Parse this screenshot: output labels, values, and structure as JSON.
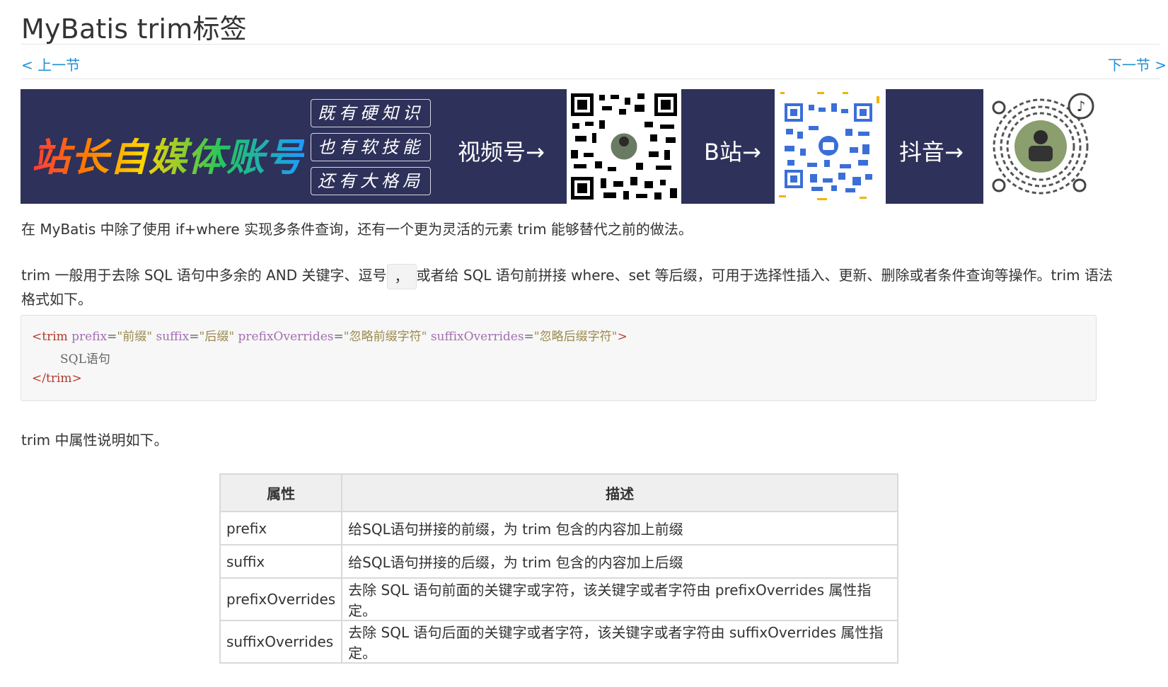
{
  "page": {
    "title": "MyBatis trim标签",
    "nav": {
      "prev": "< 上一节",
      "next": "下一节 >"
    }
  },
  "banner": {
    "brand": "站长自媒体账号",
    "slogans": [
      "既有硬知识",
      "也有软技能",
      "还有大格局"
    ],
    "labels": {
      "video": "视频号→",
      "bilibili": "B站→",
      "douyin": "抖音→"
    }
  },
  "content": {
    "intro": "在 MyBatis 中除了使用 if+where 实现多条件查询，还有一个更为灵活的元素 trim 能够替代之前的做法。",
    "p2_before": "trim 一般用于去除 SQL 语句中多余的 AND 关键字、逗号",
    "p2_code": "，",
    "p2_after": "或者给 SQL 语句前拼接 where、set 等后缀，可用于选择性插入、更新、删除或者条件查询等操作。trim 语法",
    "p2_line2": "格式如下。",
    "code": {
      "open_tag": "trim",
      "attr1_name": "prefix",
      "attr1_value": "\"前缀\"",
      "attr2_name": "suffix",
      "attr2_value": "\"后缀\"",
      "attr3_name": "prefixOverrides",
      "attr3_value": "\"忽略前缀字符\"",
      "attr4_name": "suffixOverrides",
      "attr4_value": "\"忽略后缀字符\"",
      "body": "SQL语句",
      "close_tag": "trim"
    },
    "p3": "trim 中属性说明如下。"
  },
  "table": {
    "headers": [
      "属性",
      "描述"
    ],
    "rows": [
      [
        "prefix",
        "给SQL语句拼接的前缀，为 trim 包含的内容加上前缀"
      ],
      [
        "suffix",
        "给SQL语句拼接的后缀，为 trim 包含的内容加上后缀"
      ],
      [
        "prefixOverrides",
        "去除 SQL 语句前面的关键字或字符，该关键字或者字符由 prefixOverrides 属性指定。"
      ],
      [
        "suffixOverrides",
        "去除 SQL 语句后面的关键字或者字符，该关键字或者字符由 suffixOverrides 属性指定。"
      ]
    ]
  },
  "colors": {
    "link": "#1f8fd6",
    "banner_bg": "#2e3159",
    "code_bg": "#f7f7f7",
    "table_header_bg": "#efefef"
  }
}
